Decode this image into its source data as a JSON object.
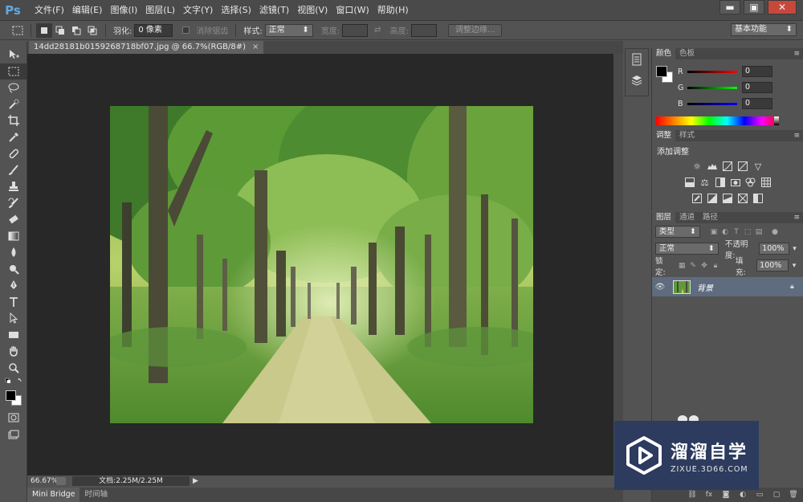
{
  "app": {
    "logo": "Ps"
  },
  "menu": [
    "文件(F)",
    "编辑(E)",
    "图像(I)",
    "图层(L)",
    "文字(Y)",
    "选择(S)",
    "滤镜(T)",
    "视图(V)",
    "窗口(W)",
    "帮助(H)"
  ],
  "window_controls": {
    "minimize": "▬",
    "maximize": "▣",
    "close": "✕"
  },
  "options_bar": {
    "feather_label": "羽化:",
    "feather_value": "0 像素",
    "antialias_label": "消除锯齿",
    "style_label": "样式:",
    "style_value": "正常",
    "width_label": "宽度:",
    "height_label": "高度:",
    "refine_edge_button": "调整边缘...",
    "workspace_value": "基本功能"
  },
  "document": {
    "tab_title": "14dd28181b0159268718bf07.jpg @ 66.7%(RGB/8#)",
    "tab_close": "×",
    "zoom": "66.67%",
    "doc_info": "文档:2.25M/2.25M"
  },
  "bottom_tabs": [
    "Mini Bridge",
    "时间轴"
  ],
  "color_panel": {
    "tabs": [
      "颜色",
      "色板"
    ],
    "r_label": "R",
    "g_label": "G",
    "b_label": "B",
    "r_value": "0",
    "g_value": "0",
    "b_value": "0"
  },
  "adjustments_panel": {
    "tabs": [
      "调整",
      "样式"
    ],
    "title": "添加调整"
  },
  "layers_panel": {
    "tabs": [
      "图层",
      "通道",
      "路径"
    ],
    "filter_value": "类型",
    "blend_mode": "正常",
    "opacity_label": "不透明度:",
    "opacity_value": "100%",
    "lock_label": "锁定:",
    "fill_label": "填充:",
    "fill_value": "100%",
    "layers": [
      {
        "name": "背景",
        "visible": true,
        "locked": true
      }
    ]
  },
  "watermark": {
    "brand_cn": "溜溜自学",
    "url": "ZIXUE.3D66.COM"
  },
  "colors": {
    "ui_bg": "#535353",
    "canvas_bg": "#282828",
    "selected_layer": "#5f6b7e",
    "accent_logo": "#62a8e0",
    "watermark_bg": "#2c3b5e"
  }
}
